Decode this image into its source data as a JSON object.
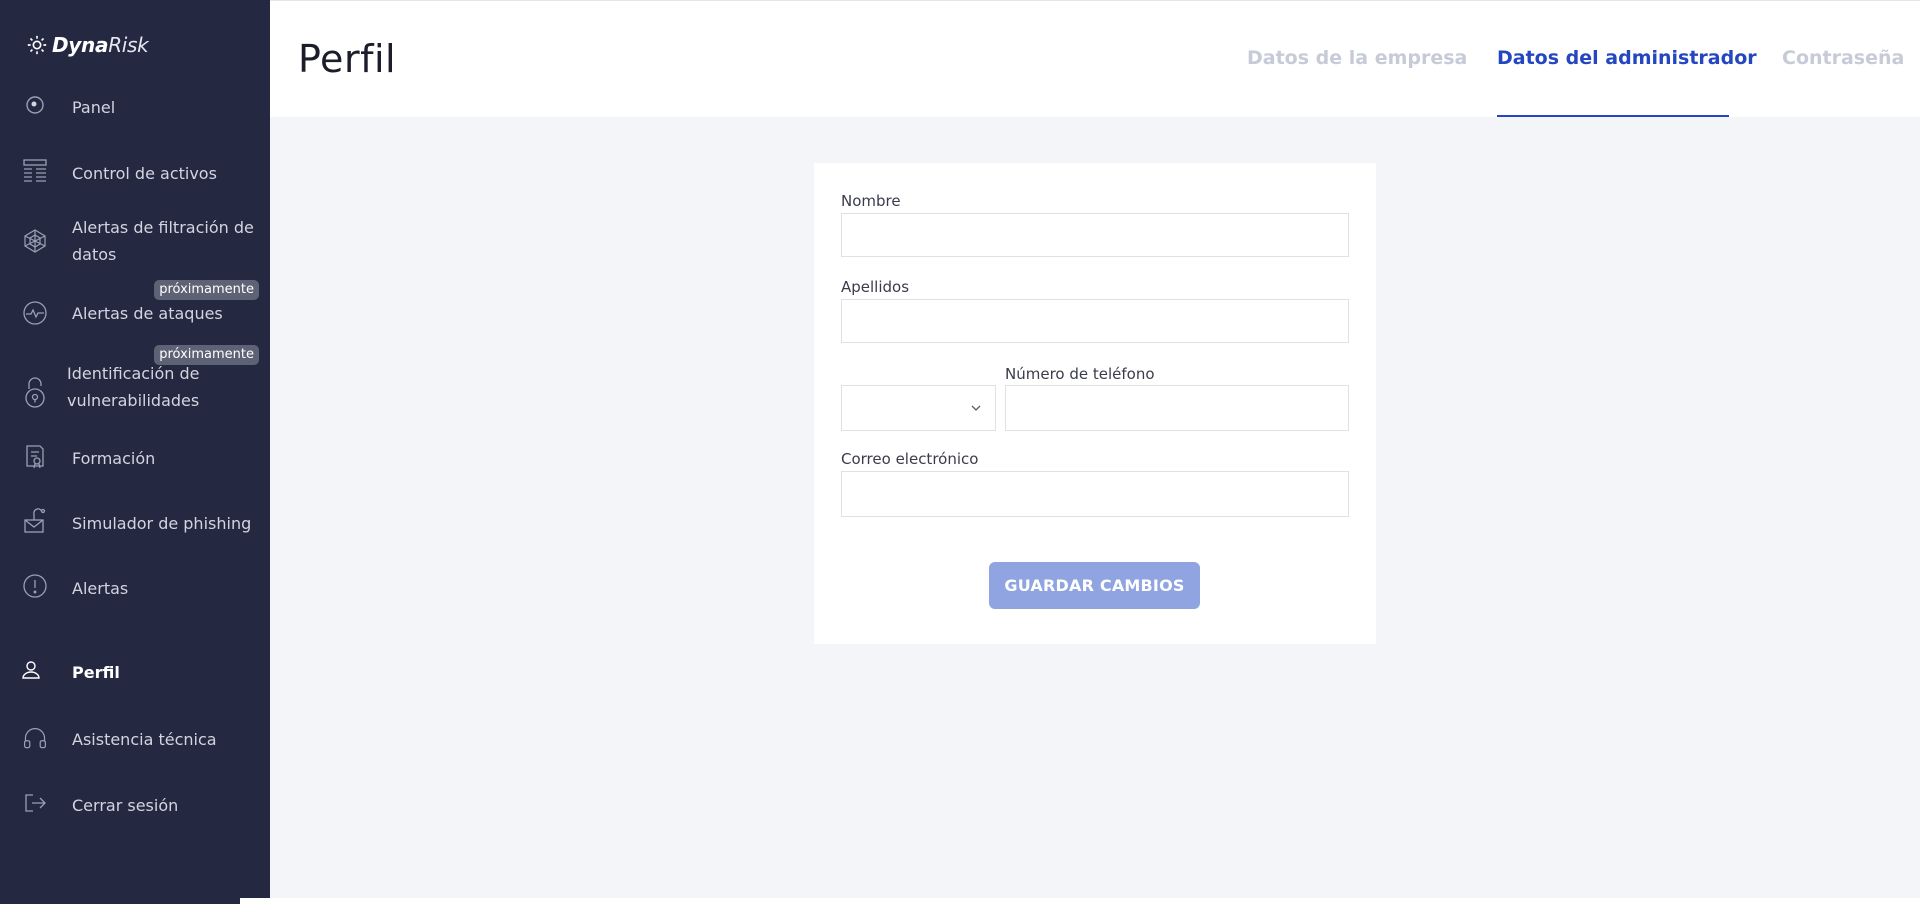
{
  "brand": {
    "name_bold": "Dyna",
    "name_light": "Risk"
  },
  "sidebar": {
    "items": [
      {
        "label": "Panel",
        "icon": "panel-icon"
      },
      {
        "label": "Control de activos",
        "icon": "assets-icon"
      },
      {
        "label_line1": "Alertas de filtración de",
        "label_line2": "datos",
        "icon": "web-icon"
      },
      {
        "label": "Alertas de ataques",
        "icon": "pulse-icon",
        "badge": "próximamente"
      },
      {
        "label_line1": "Identificación de",
        "label_line2": "vulnerabilidades",
        "icon": "lock-icon",
        "badge": "próximamente"
      },
      {
        "label": "Formación",
        "icon": "training-icon"
      },
      {
        "label": "Simulador de phishing",
        "icon": "phishing-icon"
      },
      {
        "label": "Alertas",
        "icon": "alert-icon"
      },
      {
        "label": "Perfil",
        "icon": "user-icon",
        "active": true
      },
      {
        "label": "Asistencia técnica",
        "icon": "headset-icon"
      },
      {
        "label": "Cerrar sesión",
        "icon": "logout-icon"
      }
    ]
  },
  "header": {
    "title": "Perfil",
    "tabs": [
      {
        "label": "Datos de la empresa"
      },
      {
        "label": "Datos del administrador",
        "active": true
      },
      {
        "label": "Contraseña"
      }
    ]
  },
  "form": {
    "nombre": {
      "label": "Nombre",
      "value": ""
    },
    "apellidos": {
      "label": "Apellidos",
      "value": ""
    },
    "prefix": {
      "value": ""
    },
    "telefono": {
      "label": "Número de teléfono",
      "value": ""
    },
    "correo": {
      "label": "Correo electrónico",
      "value": ""
    },
    "save_label": "GUARDAR CAMBIOS"
  },
  "colors": {
    "sidebar_bg": "#242841",
    "accent": "#2446c0",
    "button": "#8fa4e0",
    "page_bg": "#f4f5f9"
  }
}
